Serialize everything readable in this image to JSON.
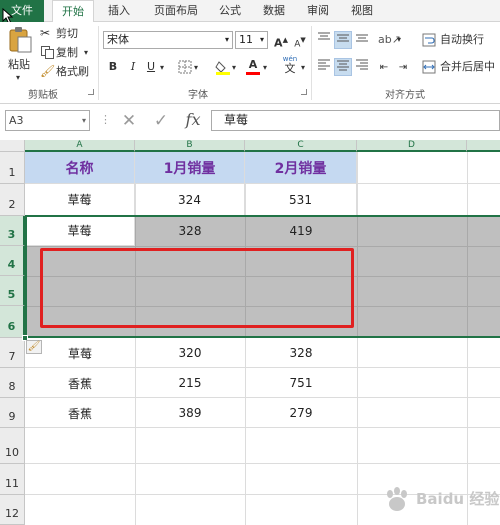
{
  "tabs": [
    "文件",
    "开始",
    "插入",
    "页面布局",
    "公式",
    "数据",
    "审阅",
    "视图"
  ],
  "clipboard": {
    "paste": "粘贴",
    "cut": "剪切",
    "copy": "复制",
    "format_painter": "格式刷",
    "group": "剪贴板"
  },
  "font": {
    "name": "宋体",
    "size": "11",
    "bold": "B",
    "italic": "I",
    "underline": "U",
    "group": "字体",
    "grow": "A",
    "shrink": "A",
    "wen": "wén",
    "wen_char": "文"
  },
  "alignment": {
    "wrap": "自动换行",
    "merge": "合并后居中",
    "group": "对齐方式"
  },
  "formula_bar": {
    "name_box": "A3",
    "fx": "fx",
    "content": "草莓"
  },
  "columns": [
    "A",
    "B",
    "C",
    "D"
  ],
  "rows": [
    "1",
    "2",
    "3",
    "4",
    "5",
    "6",
    "7",
    "8",
    "9",
    "10",
    "11",
    "12"
  ],
  "header_row": [
    "名称",
    "1月销量",
    "2月销量"
  ],
  "data_rows": [
    [
      "草莓",
      "324",
      "531"
    ],
    [
      "草莓",
      "328",
      "419"
    ],
    [
      "",
      "",
      ""
    ],
    [
      "",
      "",
      ""
    ],
    [
      "",
      "",
      ""
    ],
    [
      "草莓",
      "320",
      "328"
    ],
    [
      "香蕉",
      "215",
      "751"
    ],
    [
      "香蕉",
      "389",
      "279"
    ]
  ],
  "colors": {
    "accent": "#217346",
    "header_fill": "#c5d9f1",
    "header_text": "#7030a0",
    "selection_fill": "#bfbfbf",
    "annotation": "#e02020"
  },
  "watermark": "Baidu 经验"
}
